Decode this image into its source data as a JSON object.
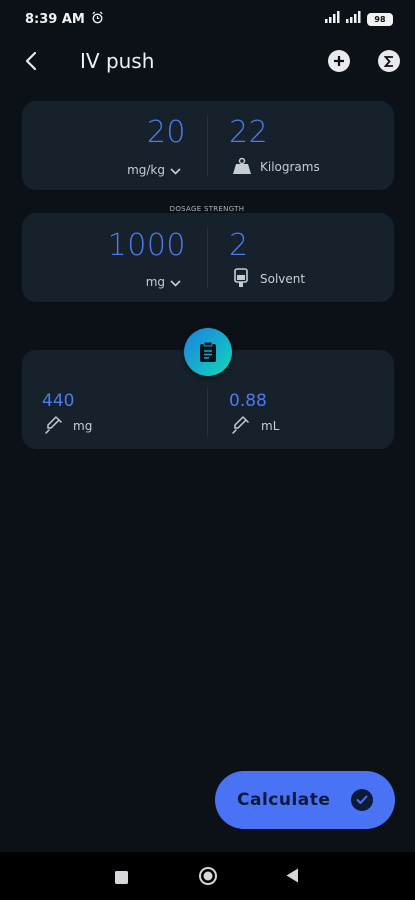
{
  "status_bar": {
    "time": "8:39 AM",
    "battery": "98",
    "icons": [
      "alarm-icon",
      "signal-icon",
      "signal-icon",
      "battery-icon"
    ]
  },
  "app_bar": {
    "title": "IV push",
    "actions": [
      "add-icon",
      "sigma-icon"
    ]
  },
  "dose_card": {
    "dose_value": "20",
    "dose_unit": "mg/kg",
    "weight_value": "22",
    "weight_unit": "Kilograms"
  },
  "section_label": "DOSAGE STRENGTH",
  "strength_card": {
    "amount_value": "1000",
    "amount_unit": "mg",
    "solvent_value": "2",
    "solvent_label": "Solvent"
  },
  "result_card": {
    "dose_value": "440",
    "dose_unit": "mg",
    "volume_value": "0.88",
    "volume_unit": "mL"
  },
  "calculate_button": {
    "label": "Calculate"
  },
  "nav_bar": {
    "items": [
      "recents-icon",
      "home-icon",
      "back-icon"
    ]
  },
  "colors": {
    "background": "#0c1118",
    "card": "#17212b",
    "accent": "#4b7bf0",
    "button": "#4a72f5"
  }
}
